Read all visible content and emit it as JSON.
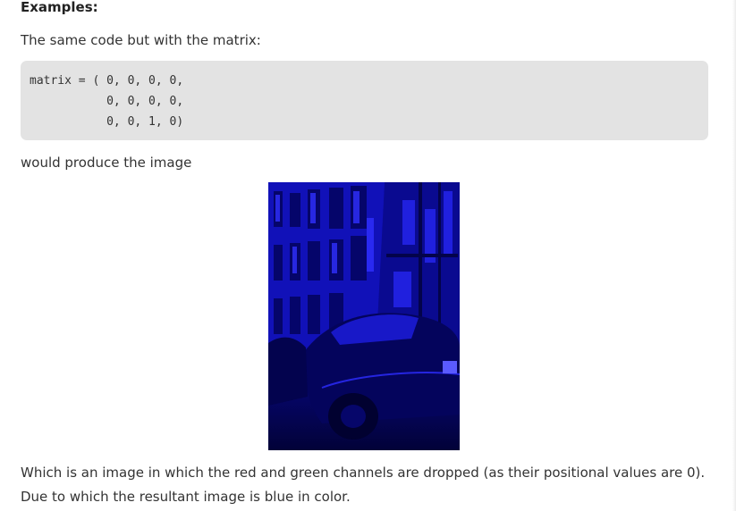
{
  "heading": "Examples:",
  "intro": "The same code but with the matrix:",
  "code": {
    "lines": [
      "matrix = ( 0, 0, 0, 0,",
      "           0, 0, 0, 0,",
      "           0, 0, 1, 0)"
    ]
  },
  "result_intro": "would produce the image",
  "image": {
    "subject": "street with buildings and parked car, blue channel only"
  },
  "conclusion": "Which is an image in which the red and green channels are dropped (as their positional values are 0). Due to which the resultant image is blue in color.",
  "colors": {
    "code_bg": "#e3e3e3",
    "image_base": "#00005a",
    "image_highlight": "#2222ff"
  }
}
